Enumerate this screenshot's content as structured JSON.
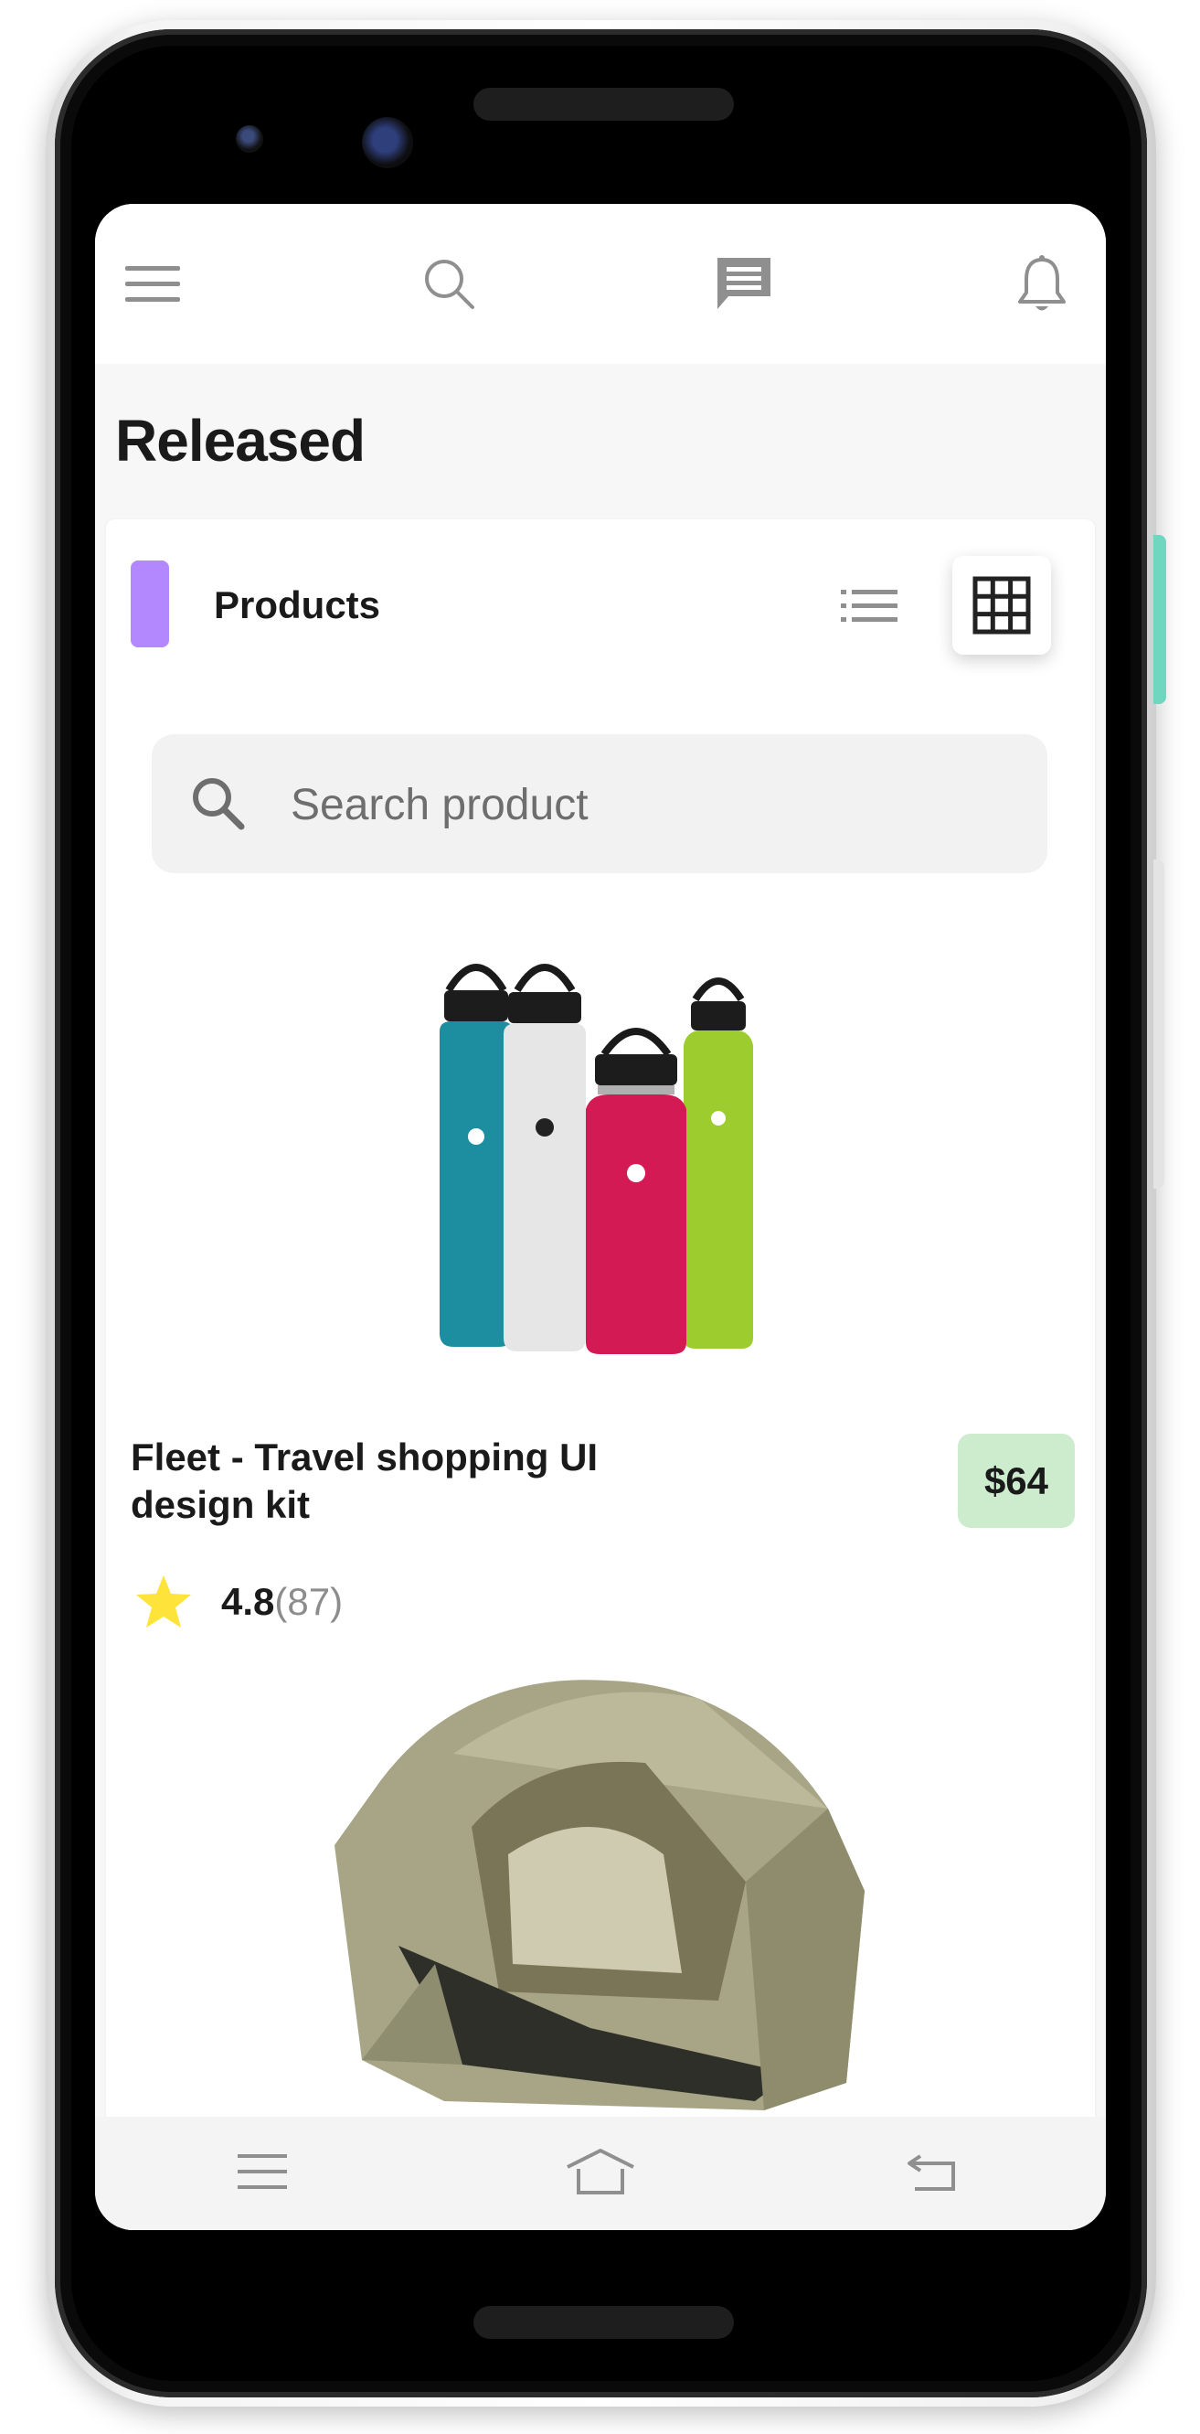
{
  "top_bar": {
    "menu_icon": "hamburger-menu-icon",
    "search_icon": "search-icon",
    "messages_icon": "chat-icon",
    "notifications_icon": "bell-icon"
  },
  "page": {
    "title": "Released"
  },
  "card": {
    "title": "Products",
    "accent_color": "#b388ff",
    "list_view_icon": "list-view-icon",
    "grid_view_icon": "grid-view-icon",
    "search": {
      "placeholder": "Search product",
      "value": ""
    }
  },
  "products": [
    {
      "image": "water-bottles-image",
      "name": "Fleet - Travel shopping UI design kit",
      "price": "$64",
      "rating": "4.8",
      "rating_count": "(87)"
    },
    {
      "image": "tent-image"
    }
  ],
  "bottom_nav": {
    "recents_icon": "recent-apps-icon",
    "home_icon": "home-icon",
    "back_icon": "back-icon"
  },
  "colors": {
    "price_badge_bg": "#cdeccd",
    "star": "#fde33a",
    "icon_grey": "#8f8f8f"
  }
}
